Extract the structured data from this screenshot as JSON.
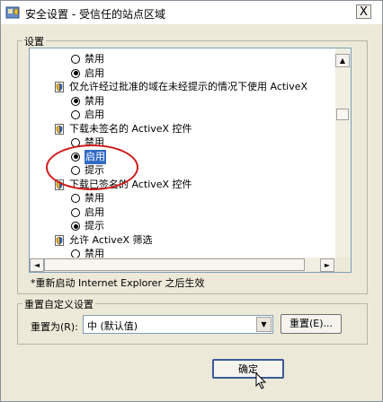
{
  "window": {
    "title": "安全设置 - 受信任的站点区域",
    "close_glyph": "X",
    "icon": "shield-window-icon"
  },
  "settings_group": {
    "label": "设置",
    "items": [
      {
        "kind": "radio",
        "label": "禁用",
        "checked": false
      },
      {
        "kind": "radio",
        "label": "启用",
        "checked": true
      },
      {
        "kind": "header",
        "label": "仅允许经过批准的域在未经提示的情况下使用 ActiveX",
        "icon": "activex-setting-icon"
      },
      {
        "kind": "radio",
        "label": "禁用",
        "checked": true
      },
      {
        "kind": "radio",
        "label": "启用",
        "checked": false
      },
      {
        "kind": "header",
        "label": "下载未签名的 ActiveX 控件",
        "icon": "activex-setting-icon"
      },
      {
        "kind": "radio",
        "label": "禁用",
        "checked": false
      },
      {
        "kind": "radio",
        "label": "启用",
        "checked": true,
        "selected": true
      },
      {
        "kind": "radio",
        "label": "提示",
        "checked": false
      },
      {
        "kind": "header",
        "label": "下载已签名的 ActiveX 控件",
        "icon": "activex-setting-icon"
      },
      {
        "kind": "radio",
        "label": "禁用",
        "checked": false
      },
      {
        "kind": "radio",
        "label": "启用",
        "checked": false
      },
      {
        "kind": "radio",
        "label": "提示",
        "checked": true
      },
      {
        "kind": "header",
        "label": "允许 ActiveX 筛选",
        "icon": "activex-setting-icon"
      },
      {
        "kind": "radio",
        "label": "禁用",
        "checked": false
      }
    ],
    "restart_note": "*重新启动 Internet Explorer 之后生效"
  },
  "reset_group": {
    "label": "重置自定义设置",
    "reset_to_label": "重置为(R):",
    "reset_to_value": "中 (默认值)",
    "reset_button": "重置(E)..."
  },
  "ok_button": "确定",
  "colors": {
    "selection": "#316ac5",
    "annotation_circle": "#d01818"
  }
}
